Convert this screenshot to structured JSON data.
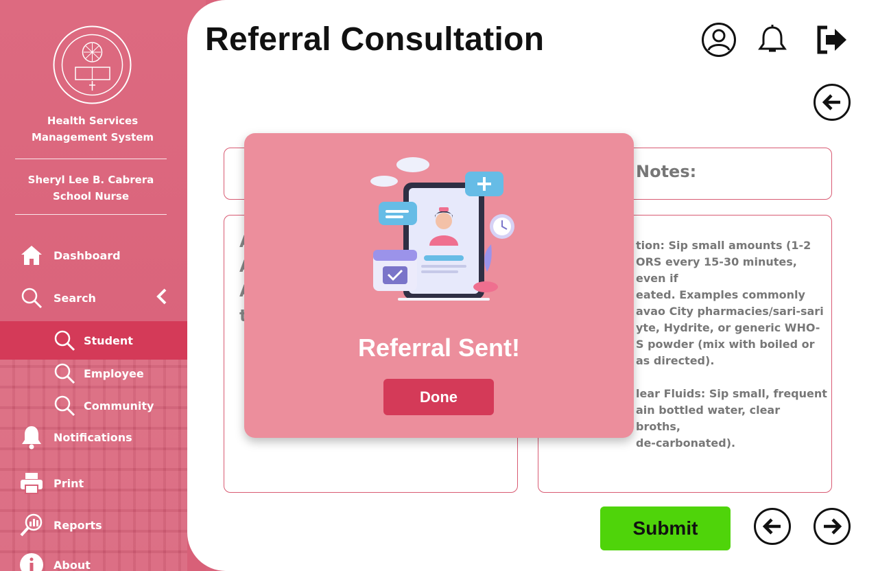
{
  "sidebar": {
    "system_name_line1": "Health Services",
    "system_name_line2": "Management System",
    "user_name": "Sheryl Lee B. Cabrera",
    "user_role": "School Nurse",
    "items": [
      {
        "label": "Dashboard",
        "icon": "home-icon"
      },
      {
        "label": "Search",
        "icon": "search-icon"
      },
      {
        "label": "Student",
        "icon": "search-icon"
      },
      {
        "label": "Employee",
        "icon": "search-icon"
      },
      {
        "label": "Community",
        "icon": "search-icon"
      },
      {
        "label": "Notifications",
        "icon": "bell-icon"
      },
      {
        "label": "Print",
        "icon": "printer-icon"
      },
      {
        "label": "Reports",
        "icon": "reports-icon"
      },
      {
        "label": "About",
        "icon": "info-icon"
      }
    ]
  },
  "header": {
    "title": "Referral Consultation"
  },
  "form": {
    "notes_title": "Notes:",
    "left_partial_letters": [
      "A",
      "A",
      "A",
      "t"
    ],
    "notes_lines": [
      "tion: Sip small amounts (1-2",
      "ORS every 15-30 minutes, even if",
      "eated. Examples commonly",
      "avao City pharmacies/sari-sari",
      "yte, Hydrite, or generic WHO-",
      "S powder (mix with boiled or",
      "as directed).",
      "",
      "lear Fluids: Sip small, frequent",
      "ain bottled water, clear broths,",
      "de-carbonated)."
    ],
    "submit_label": "Submit"
  },
  "modal": {
    "title": "Referral Sent!",
    "done_label": "Done"
  },
  "colors": {
    "sidebar": "#d9627a",
    "active": "#d43a58",
    "modal": "#ec8e9c",
    "submit": "#4fd40a",
    "border": "#d85a72"
  }
}
